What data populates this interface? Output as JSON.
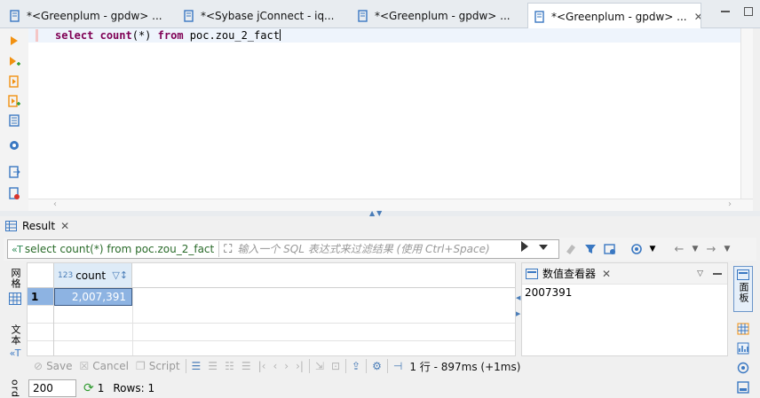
{
  "tabs": [
    {
      "label": "*<Greenplum - gpdw> ...",
      "active": false
    },
    {
      "label": "*<Sybase jConnect - iq...",
      "active": false
    },
    {
      "label": "*<Greenplum - gpdw> ...",
      "active": false
    },
    {
      "label": "*<Greenplum - gpdw> ...",
      "active": true
    }
  ],
  "editor": {
    "sql_keyword1": "select",
    "sql_func": "count",
    "sql_args": "(*)",
    "sql_keyword2": "from",
    "sql_table": "poc.zou_2_fact"
  },
  "result_tab": {
    "label": "Result"
  },
  "filter": {
    "query_label": "select count(*) from poc.zou_2_fact",
    "placeholder": "输入一个 SQL 表达式来过滤结果 (使用 Ctrl+Space)"
  },
  "view_modes": {
    "grid": "网格",
    "text": "文本",
    "record": "ord"
  },
  "grid": {
    "columns": [
      {
        "name": "count",
        "type_icon": "123"
      }
    ],
    "rows": [
      {
        "num": "1",
        "values": [
          "2,007,391"
        ]
      }
    ]
  },
  "value_viewer": {
    "title": "数值查看器",
    "value": "2007391"
  },
  "right_panel": {
    "label": "面板"
  },
  "bottom_toolbar": {
    "save": "Save",
    "cancel": "Cancel",
    "script": "Script",
    "status": "1 行 - 897ms (+1ms)"
  },
  "fetch": {
    "size": "200",
    "count": "1",
    "rows_label": "Rows: 1"
  },
  "colors": {
    "keyword": "#7f0055",
    "selection": "#8db3e2",
    "accent": "#4a7db8"
  }
}
